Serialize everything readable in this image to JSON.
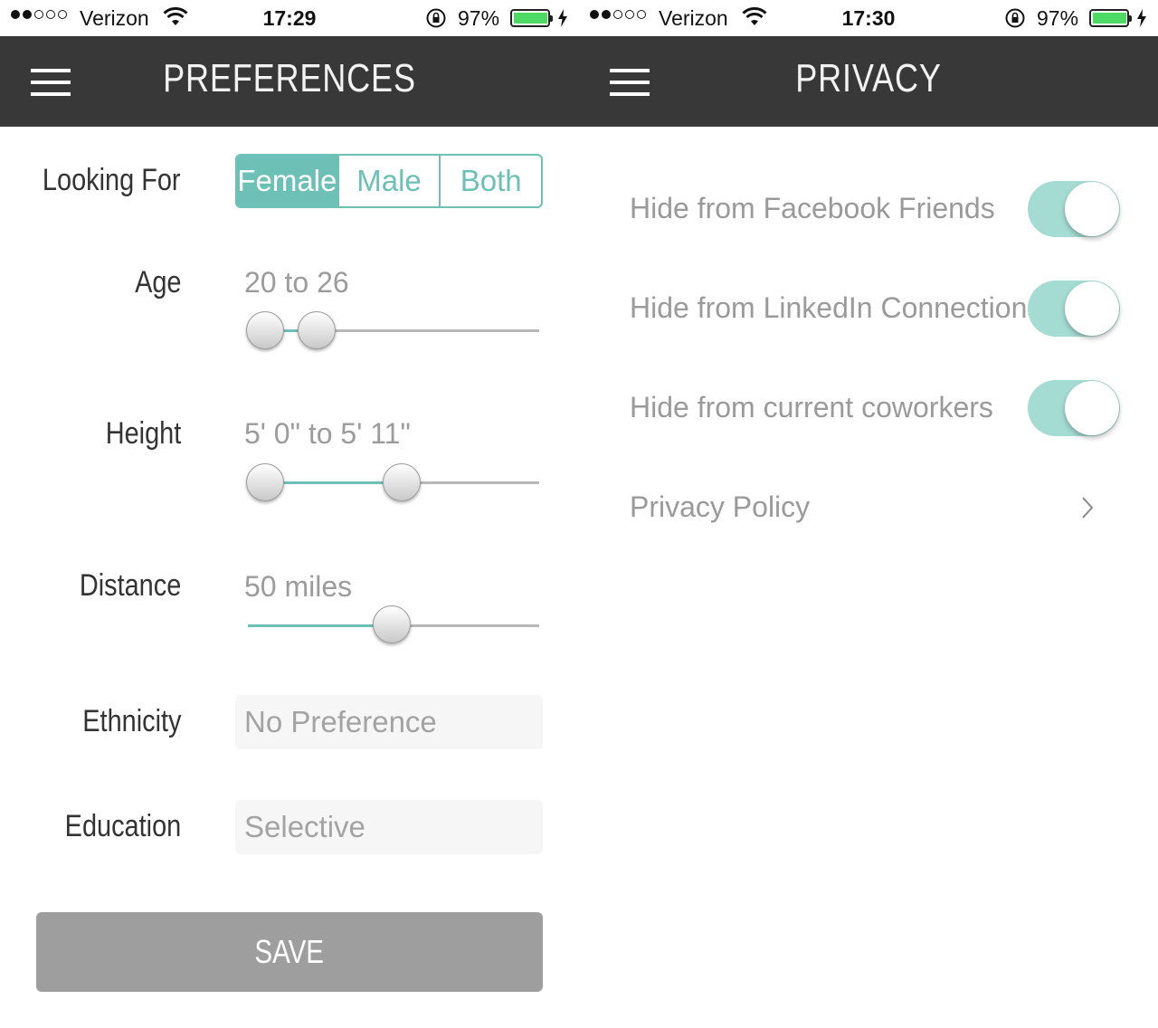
{
  "left_screen": {
    "status": {
      "carrier": "Verizon",
      "time": "17:29",
      "battery": "97%"
    },
    "nav": {
      "title": "PREFERENCES"
    },
    "looking_for": {
      "label": "Looking For",
      "options": [
        "Female",
        "Male",
        "Both"
      ],
      "selected": "Female"
    },
    "age": {
      "label": "Age",
      "value": "20 to 26"
    },
    "height": {
      "label": "Height",
      "value": "5' 0\" to 5' 11\""
    },
    "distance": {
      "label": "Distance",
      "value": "50 miles"
    },
    "ethnicity": {
      "label": "Ethnicity",
      "value": "No Preference"
    },
    "education": {
      "label": "Education",
      "value": "Selective"
    },
    "save_label": "SAVE"
  },
  "right_screen": {
    "status": {
      "carrier": "Verizon",
      "time": "17:30",
      "battery": "97%"
    },
    "nav": {
      "title": "PRIVACY"
    },
    "toggles": [
      {
        "label": "Hide from Facebook Friends",
        "on": true
      },
      {
        "label": "Hide from LinkedIn Connections",
        "on": true
      },
      {
        "label": "Hide from current coworkers",
        "on": true
      }
    ],
    "privacy_policy": "Privacy Policy"
  },
  "colors": {
    "accent": "#6cc0b5",
    "nav_bg": "#383838",
    "toggle_on": "#a4dcd3",
    "save_bg": "#9e9e9e"
  },
  "icons": [
    "menu-icon",
    "wifi-icon",
    "rotation-lock-icon",
    "battery-icon",
    "charging-bolt-icon",
    "chevron-right-icon"
  ]
}
